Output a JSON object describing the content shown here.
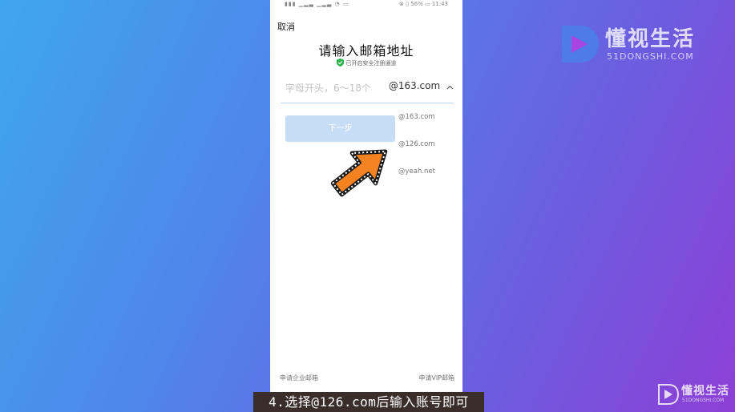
{
  "status_bar": {
    "left": "▮▮▮ ▁▂▃ ▁▂▃ ◔ ▭",
    "right": "⊗ ▯ 56% ▭ 11:43"
  },
  "cancel_label": "取消",
  "title": "请输入邮箱地址",
  "secure_text": "已开启安全注册通道",
  "email_input": {
    "placeholder": "字母开头，6～18个",
    "selected_domain": "@163.com"
  },
  "next_button_label": "下一步",
  "domain_options": [
    "@163.com",
    "@126.com",
    "@yeah.net"
  ],
  "footer": {
    "left_link": "申请企业邮箱",
    "right_link": "申请VIP邮箱"
  },
  "brand": {
    "title": "懂视生活",
    "subtitle": "51DONGSHI.COM"
  },
  "caption": "4.选择@126.com后输入账号即可",
  "colors": {
    "accent_arrow": "#f58220",
    "button_disabled": "#c7dcf5",
    "secure_green": "#2eb24a"
  },
  "icons": [
    "shield-check-icon",
    "chevron-up-icon",
    "pointer-arrow-icon",
    "brand-logo-icon"
  ]
}
